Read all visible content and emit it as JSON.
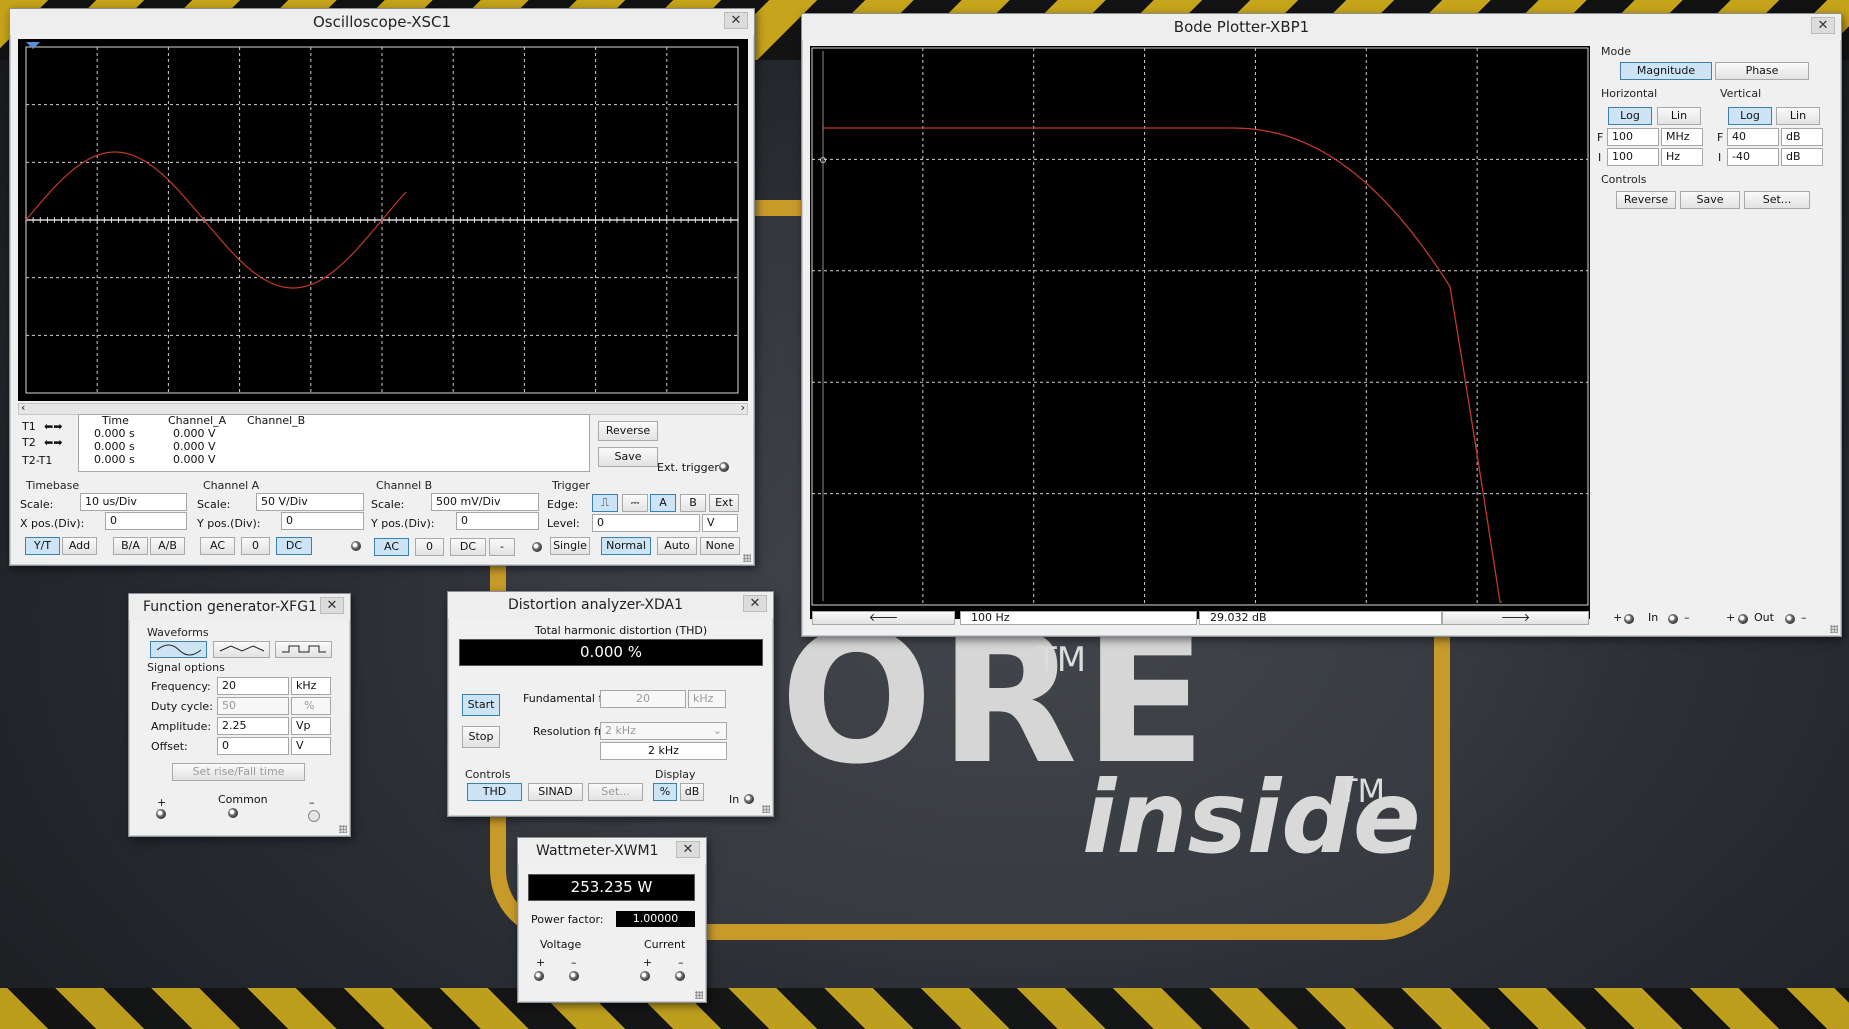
{
  "wallpaper": {
    "brand_word": "ORE",
    "tm": "TM",
    "inside_word": "inside"
  },
  "oscilloscope": {
    "title": "Oscilloscope-XSC1",
    "close": "✕",
    "cursor_rows": [
      {
        "label": "T1"
      },
      {
        "label": "T2"
      },
      {
        "label": "T2-T1"
      }
    ],
    "readout_headers": [
      "Time",
      "Channel_A",
      "Channel_B"
    ],
    "readout_rows": [
      {
        "time": "0.000 s",
        "a": "0.000 V",
        "b": ""
      },
      {
        "time": "0.000 s",
        "a": "0.000 V",
        "b": ""
      },
      {
        "time": "0.000 s",
        "a": "0.000 V",
        "b": ""
      }
    ],
    "reverse": "Reverse",
    "save": "Save",
    "ext_trigger": "Ext. trigger",
    "timebase": {
      "group": "Timebase",
      "scale_label": "Scale:",
      "scale": "10 us/Div",
      "xpos_label": "X pos.(Div):",
      "xpos": "0",
      "buttons": [
        "Y/T",
        "Add",
        "B/A",
        "A/B"
      ]
    },
    "channel_a": {
      "group": "Channel A",
      "scale_label": "Scale:",
      "scale": "50  V/Div",
      "ypos_label": "Y pos.(Div):",
      "ypos": "0",
      "buttons": [
        "AC",
        "0",
        "DC"
      ]
    },
    "channel_b": {
      "group": "Channel B",
      "scale_label": "Scale:",
      "scale": "500 mV/Div",
      "ypos_label": "Y pos.(Div):",
      "ypos": "0",
      "buttons": [
        "AC",
        "0",
        "DC",
        "-"
      ]
    },
    "trigger": {
      "group": "Trigger",
      "edge_label": "Edge:",
      "level_label": "Level:",
      "level": "0",
      "level_unit": "V",
      "edge_buttons": [
        "A",
        "B",
        "Ext"
      ],
      "mode_buttons": [
        "Single",
        "Normal",
        "Auto",
        "None"
      ]
    },
    "trace_color": "#c0392b"
  },
  "bode": {
    "title": "Bode Plotter-XBP1",
    "close": "✕",
    "mode_group": "Mode",
    "magnitude": "Magnitude",
    "phase": "Phase",
    "horizontal_group": "Horizontal",
    "vertical_group": "Vertical",
    "log": "Log",
    "lin": "Lin",
    "f_label": "F",
    "i_label": "I",
    "h_f_value": "100",
    "h_f_unit": "MHz",
    "h_i_value": "100",
    "h_i_unit": "Hz",
    "v_f_value": "40",
    "v_f_unit": "dB",
    "v_i_value": "-40",
    "v_i_unit": "dB",
    "controls_group": "Controls",
    "reverse": "Reverse",
    "save": "Save",
    "set": "Set...",
    "freq_readout": "100  Hz",
    "db_readout": "29.032 dB",
    "left_arrow": "🡐",
    "right_arrow": "🡒",
    "in_label": "In",
    "out_label": "Out",
    "plus": "+",
    "minus": "–"
  },
  "funcgen": {
    "title": "Function generator-XFG1",
    "close": "✕",
    "waveforms_group": "Waveforms",
    "signal_group": "Signal options",
    "rows": [
      {
        "label": "Frequency:",
        "value": "20",
        "unit": "kHz",
        "disabled": false
      },
      {
        "label": "Duty cycle:",
        "value": "50",
        "unit": "%",
        "disabled": true
      },
      {
        "label": "Amplitude:",
        "value": "2.25",
        "unit": "Vp",
        "disabled": false
      },
      {
        "label": "Offset:",
        "value": "0",
        "unit": "V",
        "disabled": false
      }
    ],
    "rise_fall": "Set rise/Fall time",
    "plus": "+",
    "common": "Common",
    "minus": "–"
  },
  "distortion": {
    "title": "Distortion analyzer-XDA1",
    "close": "✕",
    "thd_header": "Total harmonic distortion (THD)",
    "thd_value": "0.000 %",
    "start": "Start",
    "stop": "Stop",
    "fund_label": "Fundamental freq.",
    "fund_value": "20",
    "fund_unit": "kHz",
    "res_label": "Resolution freq.",
    "res_value": "2 kHz",
    "res_readout": "2 kHz",
    "controls_group": "Controls",
    "display_group": "Display",
    "thd_btn": "THD",
    "sinad_btn": "SINAD",
    "set_btn": "Set...",
    "pct_btn": "%",
    "db_btn": "dB",
    "in_label": "In"
  },
  "wattmeter": {
    "title": "Wattmeter-XWM1",
    "close": "✕",
    "power": "253.235 W",
    "pf_label": "Power factor:",
    "pf_value": "1.00000",
    "voltage": "Voltage",
    "current": "Current",
    "plus": "+",
    "minus": "–"
  }
}
